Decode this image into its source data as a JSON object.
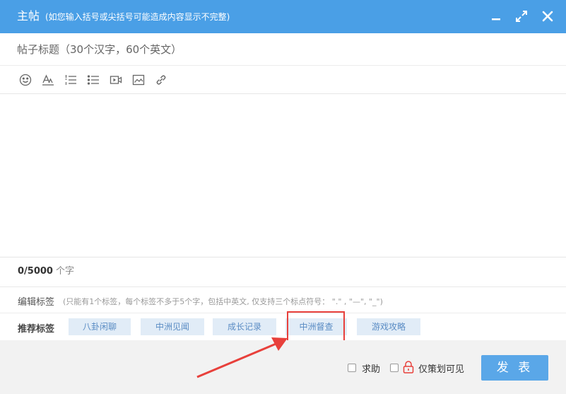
{
  "header": {
    "title": "主帖",
    "note": "(如您输入括号或尖括号可能造成内容显示不完整)",
    "icons": [
      "minimize-icon",
      "fullscreen-icon",
      "close-icon"
    ]
  },
  "title_input": {
    "placeholder": "帖子标题（30个汉字，60个英文）",
    "value": ""
  },
  "toolbar": {
    "icons": [
      "emoji-icon",
      "font-style-icon",
      "ordered-list-icon",
      "unordered-list-icon",
      "video-icon",
      "image-icon",
      "link-icon"
    ]
  },
  "counter": {
    "value": "0/5000",
    "unit": "个字"
  },
  "tag_editor": {
    "label": "编辑标签",
    "hint": "(只能有1个标签，每个标签不多于5个字，包括中英文, 仅支持三个标点符号：  \".\" , \"—\", \"_\")"
  },
  "recommended_tags": {
    "label": "推荐标签",
    "tags": [
      "八卦闲聊",
      "中洲见闻",
      "成长记录",
      "中洲督查",
      "游戏攻略"
    ]
  },
  "footer": {
    "help_label": "求助",
    "private_label": "仅策划可见",
    "submit_label": "发 表"
  },
  "colors": {
    "header": "#4a9fe6",
    "tag_bg": "#e1ecf7",
    "tag_text": "#5a8cc4",
    "submit": "#5aa7e8",
    "annotation": "#e8403b"
  }
}
